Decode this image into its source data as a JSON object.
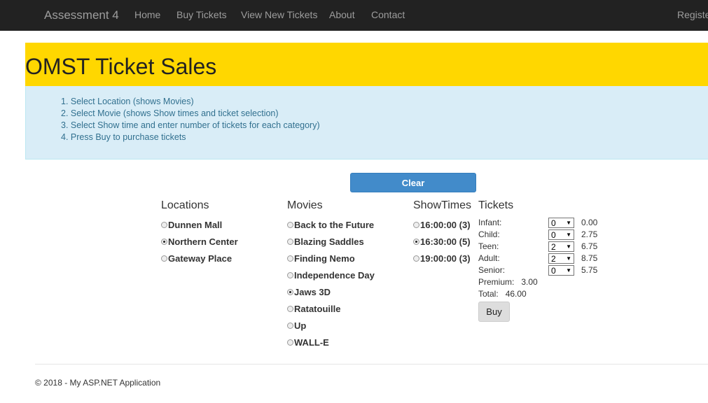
{
  "navbar": {
    "brand": "Assessment 4",
    "links": [
      "Home",
      "Buy Tickets",
      "View New Tickets",
      "About",
      "Contact"
    ],
    "right_link": "Registe"
  },
  "banner": {
    "title": "OMST Ticket Sales"
  },
  "instructions": [
    "1. Select Location (shows Movies)",
    "2. Select Movie (shows Show times and ticket selection)",
    "3. Select Show time and enter number of tickets for each category)",
    "4. Press Buy to purchase tickets"
  ],
  "clear_label": "Clear",
  "locations": {
    "header": "Locations",
    "items": [
      {
        "label": "Dunnen Mall",
        "checked": false
      },
      {
        "label": "Northern Center",
        "checked": true
      },
      {
        "label": "Gateway Place",
        "checked": false
      }
    ]
  },
  "movies": {
    "header": "Movies",
    "items": [
      {
        "label": "Back to the Future",
        "checked": false
      },
      {
        "label": "Blazing Saddles",
        "checked": false
      },
      {
        "label": "Finding Nemo",
        "checked": false
      },
      {
        "label": "Independence Day",
        "checked": false
      },
      {
        "label": "Jaws 3D",
        "checked": true
      },
      {
        "label": "Ratatouille",
        "checked": false
      },
      {
        "label": "Up",
        "checked": false
      },
      {
        "label": "WALL-E",
        "checked": false
      }
    ]
  },
  "showtimes": {
    "header": "ShowTimes",
    "items": [
      {
        "label": "16:00:00 (3)",
        "checked": false
      },
      {
        "label": "16:30:00 (5)",
        "checked": true
      },
      {
        "label": "19:00:00 (3)",
        "checked": false
      }
    ]
  },
  "tickets": {
    "header": "Tickets",
    "rows": [
      {
        "label": "Infant:",
        "qty": "0",
        "price": "0.00"
      },
      {
        "label": "Child:",
        "qty": "0",
        "price": "2.75"
      },
      {
        "label": "Teen:",
        "qty": "2",
        "price": "6.75"
      },
      {
        "label": "Adult:",
        "qty": "2",
        "price": "8.75"
      },
      {
        "label": "Senior:",
        "qty": "0",
        "price": "5.75"
      }
    ],
    "premium_label": "Premium:",
    "premium_value": "3.00",
    "total_label": "Total:",
    "total_value": "46.00",
    "buy_label": "Buy"
  },
  "footer": "© 2018 - My ASP.NET Application"
}
